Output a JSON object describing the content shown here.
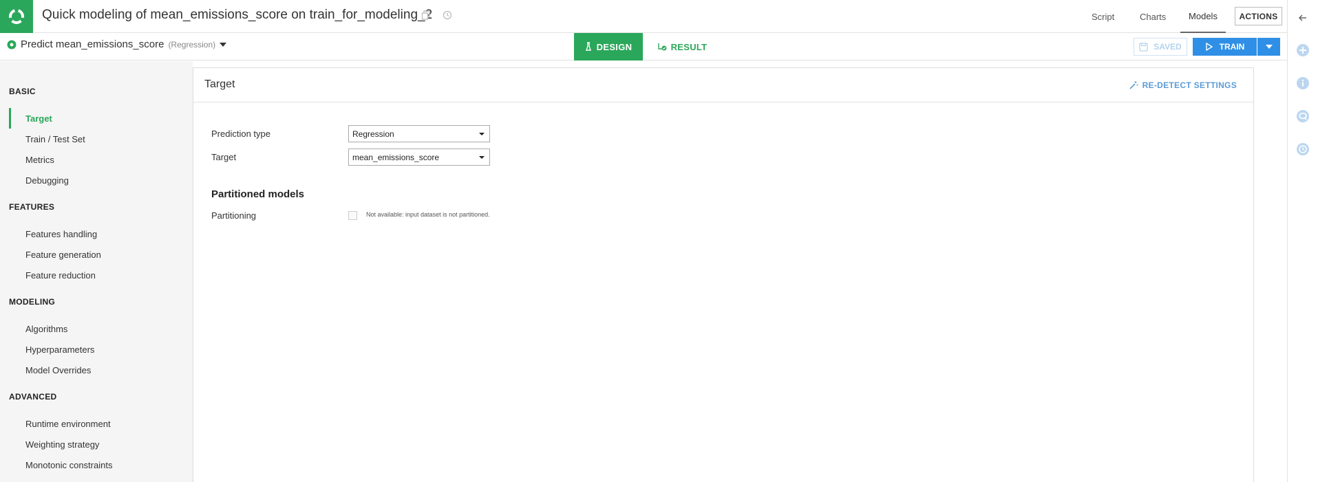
{
  "header": {
    "title": "Quick modeling of mean_emissions_score on train_for_modeling_2",
    "nav": [
      {
        "label": "Script",
        "active": false
      },
      {
        "label": "Charts",
        "active": false
      },
      {
        "label": "Models",
        "active": true
      }
    ],
    "actions_label": "ACTIONS"
  },
  "subbar": {
    "predict_label": "Predict mean_emissions_score",
    "predict_type": "(Regression)",
    "design_label": "DESIGN",
    "result_label": "RESULT",
    "saved_label": "SAVED",
    "train_label": "TRAIN"
  },
  "sidebar": {
    "sections": [
      {
        "heading": "BASIC",
        "items": [
          "Target",
          "Train / Test Set",
          "Metrics",
          "Debugging"
        ]
      },
      {
        "heading": "FEATURES",
        "items": [
          "Features handling",
          "Feature generation",
          "Feature reduction"
        ]
      },
      {
        "heading": "MODELING",
        "items": [
          "Algorithms",
          "Hyperparameters",
          "Model Overrides"
        ]
      },
      {
        "heading": "ADVANCED",
        "items": [
          "Runtime environment",
          "Weighting strategy",
          "Monotonic constraints"
        ]
      }
    ],
    "active_item": "Target"
  },
  "main": {
    "card_title": "Target",
    "redetect_label": "RE-DETECT SETTINGS",
    "prediction_type_label": "Prediction type",
    "prediction_type_value": "Regression",
    "target_label": "Target",
    "target_value": "mean_emissions_score",
    "partitioned_heading": "Partitioned models",
    "partitioning_label": "Partitioning",
    "partitioning_note": "Not available: input dataset is not partitioned."
  },
  "colors": {
    "brand_green": "#2aa75a",
    "primary_blue": "#2f8fe6",
    "link_blue": "#5b9bd5"
  },
  "icons": [
    "logo-icon",
    "copy-icon",
    "history-icon",
    "chevron-down-icon",
    "flask-icon",
    "result-check-icon",
    "save-icon",
    "play-icon",
    "wand-icon",
    "arrow-left-icon",
    "plus-circle-icon",
    "info-icon",
    "chat-icon",
    "clock-icon"
  ]
}
